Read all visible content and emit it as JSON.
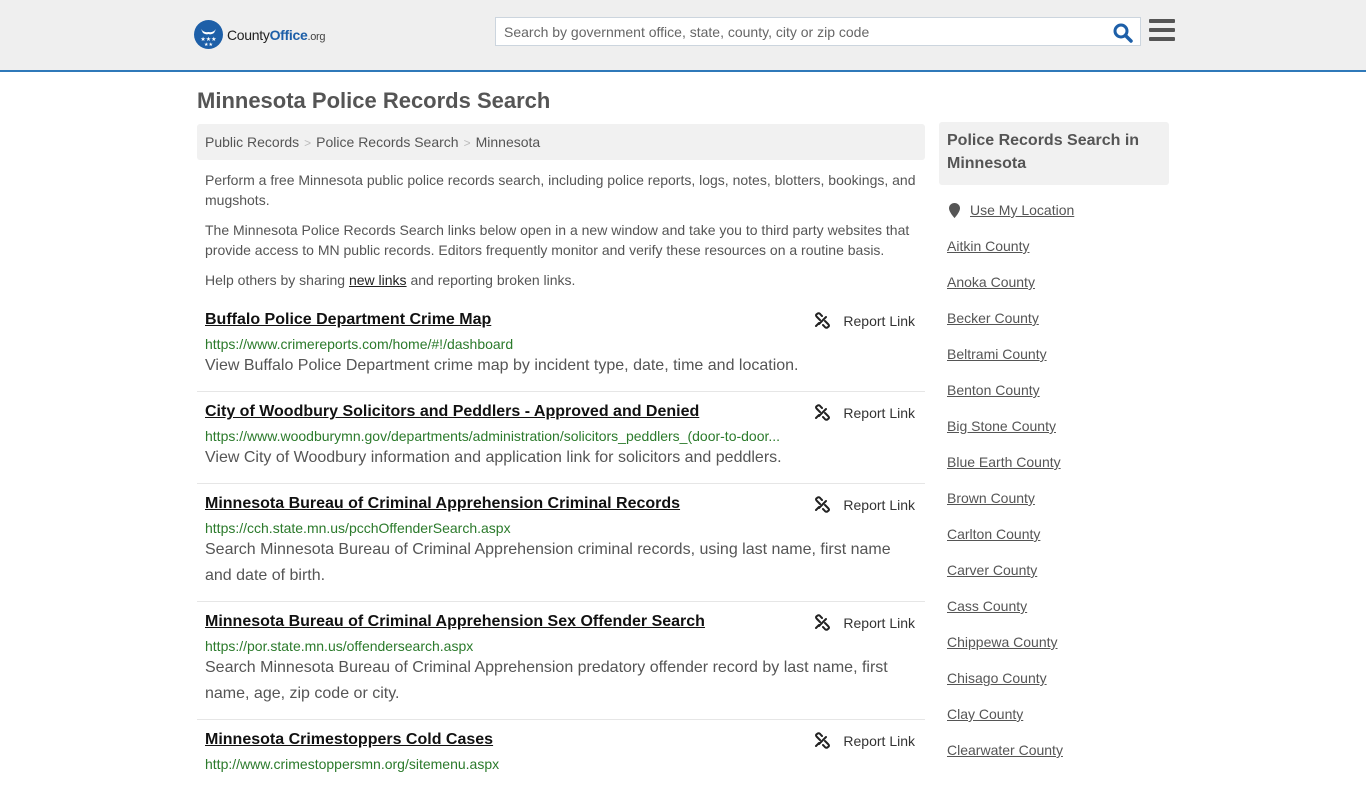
{
  "header": {
    "logo": {
      "prefix": "County",
      "brand": "Office",
      "suffix": ".org"
    },
    "search": {
      "placeholder": "Search by government office, state, county, city or zip code",
      "value": ""
    },
    "colors": {
      "brand": "#1d5fa8",
      "accent_border": "#2f79b9"
    }
  },
  "page": {
    "title": "Minnesota Police Records Search"
  },
  "breadcrumb": [
    {
      "label": "Public Records"
    },
    {
      "label": "Police Records Search"
    },
    {
      "label": "Minnesota"
    }
  ],
  "intro": {
    "p1": "Perform a free Minnesota public police records search, including police reports, logs, notes, blotters, bookings, and mugshots.",
    "p2": "The Minnesota Police Records Search links below open in a new window and take you to third party websites that provide access to MN public records. Editors frequently monitor and verify these resources on a routine basis.",
    "p3_before": "Help others by sharing ",
    "p3_link": "new links",
    "p3_after": " and reporting broken links."
  },
  "results": [
    {
      "title": "Buffalo Police Department Crime Map",
      "url": "https://www.crimereports.com/home/#!/dashboard",
      "description": "View Buffalo Police Department crime map by incident type, date, time and location.",
      "report_label": "Report Link"
    },
    {
      "title": "City of Woodbury Solicitors and Peddlers - Approved and Denied",
      "url": "https://www.woodburymn.gov/departments/administration/solicitors_peddlers_(door-to-door...",
      "description": "View City of Woodbury information and application link for solicitors and peddlers.",
      "report_label": "Report Link"
    },
    {
      "title": "Minnesota Bureau of Criminal Apprehension Criminal Records",
      "url": "https://cch.state.mn.us/pcchOffenderSearch.aspx",
      "description": "Search Minnesota Bureau of Criminal Apprehension criminal records, using last name, first name and date of birth.",
      "report_label": "Report Link"
    },
    {
      "title": "Minnesota Bureau of Criminal Apprehension Sex Offender Search",
      "url": "https://por.state.mn.us/offendersearch.aspx",
      "description": "Search Minnesota Bureau of Criminal Apprehension predatory offender record by last name, first name, age, zip code or city.",
      "report_label": "Report Link"
    },
    {
      "title": "Minnesota Crimestoppers Cold Cases",
      "url": "http://www.crimestoppersmn.org/sitemenu.aspx",
      "description": "",
      "report_label": "Report Link"
    }
  ],
  "sidebar": {
    "title": "Police Records Search in Minnesota",
    "use_location": "Use My Location",
    "counties": [
      "Aitkin County",
      "Anoka County",
      "Becker County",
      "Beltrami County",
      "Benton County",
      "Big Stone County",
      "Blue Earth County",
      "Brown County",
      "Carlton County",
      "Carver County",
      "Cass County",
      "Chippewa County",
      "Chisago County",
      "Clay County",
      "Clearwater County"
    ]
  }
}
